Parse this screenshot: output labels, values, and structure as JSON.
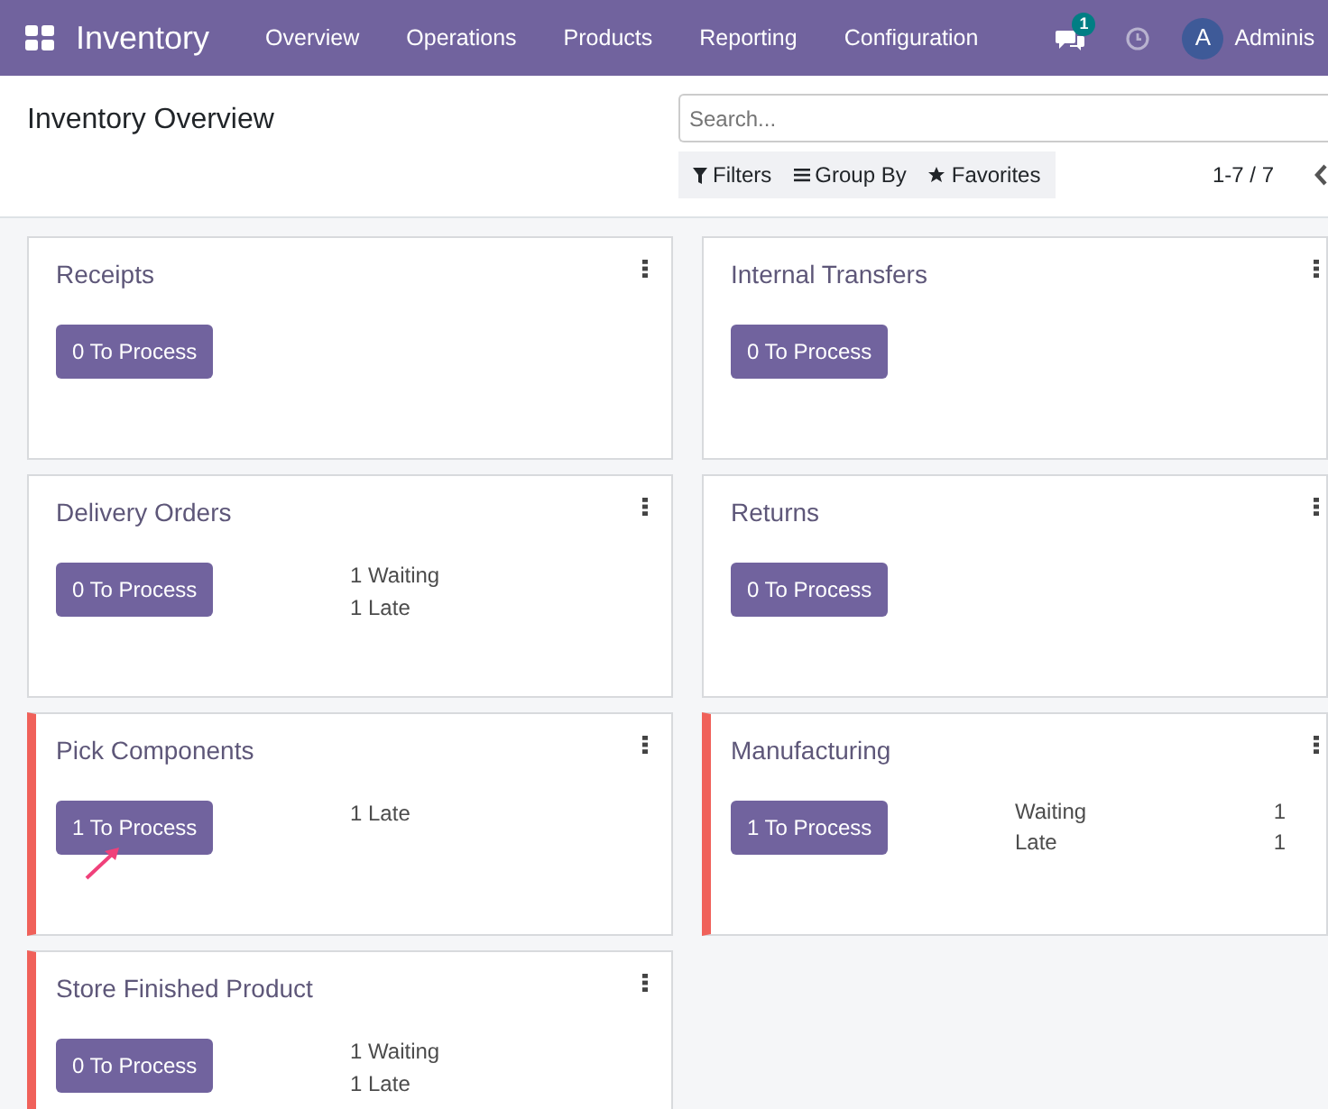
{
  "navbar": {
    "app_name": "Inventory",
    "menu": [
      {
        "label": "Overview"
      },
      {
        "label": "Operations"
      },
      {
        "label": "Products"
      },
      {
        "label": "Reporting"
      },
      {
        "label": "Configuration"
      }
    ],
    "messages_badge": "1",
    "avatar_letter": "A",
    "user_name": "Adminis"
  },
  "control_panel": {
    "title": "Inventory Overview",
    "search": {
      "placeholder": "Search..."
    },
    "filters": [
      {
        "kind": "filter",
        "label": "Filters"
      },
      {
        "kind": "group",
        "label": "Group By"
      },
      {
        "kind": "favorite",
        "label": "Favorites"
      }
    ],
    "pager": "1-7 / 7"
  },
  "cards": [
    {
      "title": "Receipts",
      "button": "0 To Process",
      "alert": false,
      "annotated": false
    },
    {
      "title": "Internal Transfers",
      "button": "0 To Process",
      "alert": false,
      "annotated": false
    },
    {
      "title": "Delivery Orders",
      "button": "0 To Process",
      "alert": false,
      "annotated": false,
      "stats": [
        {
          "kind": "line",
          "text": "1 Waiting"
        },
        {
          "kind": "line",
          "text": "1 Late"
        }
      ]
    },
    {
      "title": "Returns",
      "button": "0 To Process",
      "alert": false,
      "annotated": false
    },
    {
      "title": "Pick Components",
      "button": "1 To Process",
      "alert": true,
      "annotated": true,
      "stats": [
        {
          "kind": "line",
          "text": "1 Late"
        }
      ]
    },
    {
      "title": "Manufacturing",
      "button": "1 To Process",
      "alert": true,
      "annotated": false,
      "stats": [
        {
          "kind": "pair",
          "label": "Waiting",
          "value": "1"
        },
        {
          "kind": "pair",
          "label": "Late",
          "value": "1"
        }
      ]
    },
    {
      "title": "Store Finished Product",
      "button": "0 To Process",
      "alert": true,
      "annotated": false,
      "stats": [
        {
          "kind": "line",
          "text": "1 Waiting"
        },
        {
          "kind": "line",
          "text": "1 Late"
        }
      ]
    }
  ]
}
